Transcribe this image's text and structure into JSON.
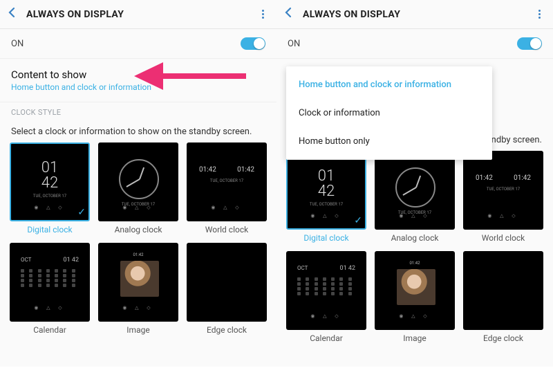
{
  "header": {
    "title": "ALWAYS ON DISPLAY"
  },
  "on_row": {
    "label": "ON"
  },
  "content_to_show": {
    "heading": "Content to show",
    "value": "Home button and clock or information"
  },
  "section": {
    "clock_style": "CLOCK STYLE"
  },
  "instruction": "Select a clock or information to show on the standby screen.",
  "instruction_right_tail": "andby screen.",
  "clocks": [
    {
      "label": "Digital clock",
      "hhmm_top": "01",
      "hhmm_bot": "42",
      "date": "TUE, OCTOBER 17",
      "selected": true
    },
    {
      "label": "Analog clock"
    },
    {
      "label": "World clock",
      "t1": "01:42",
      "t2": "01:42"
    },
    {
      "label": "Calendar",
      "mon": "OCT",
      "time": "01 42"
    },
    {
      "label": "Image",
      "time": "01:42"
    },
    {
      "label": "Edge clock"
    }
  ],
  "menu": {
    "options": [
      "Home button and clock or information",
      "Clock or information",
      "Home button only"
    ]
  }
}
